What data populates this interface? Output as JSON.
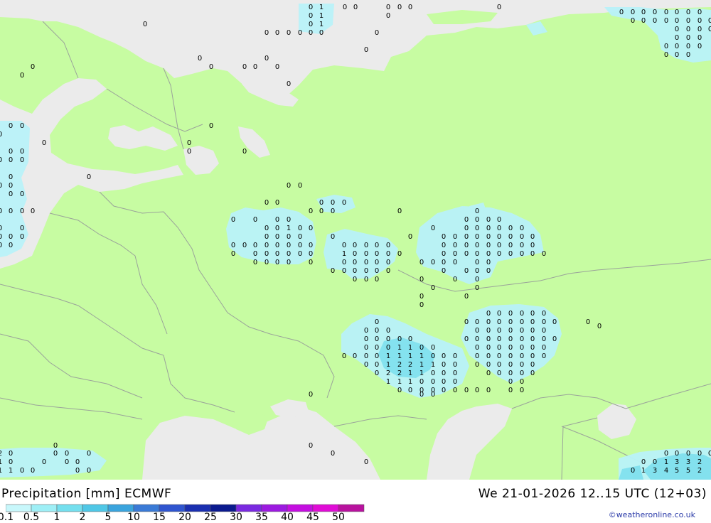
{
  "title": "Precipitation [mm] ECMWF",
  "datetime": "We 21-01-2026 12..15 UTC (12+03)",
  "credit": "©weatheronline.co.uk",
  "colors": {
    "land": "#c7fca2",
    "sea": "#ebebeb",
    "border": "#9aa39a",
    "precip_light": "#b9f2f9",
    "precip_medium": "#7ee0ee"
  },
  "legend": {
    "ticks": [
      "0.1",
      "0.5",
      "1",
      "2",
      "5",
      "10",
      "15",
      "20",
      "25",
      "30",
      "35",
      "40",
      "45",
      "50"
    ],
    "swatches": [
      "#c8f7fb",
      "#9eeff6",
      "#74dfee",
      "#4fc7e6",
      "#3aa4dd",
      "#3a7ad6",
      "#2f55cf",
      "#1a2fb0",
      "#0b1a8e",
      "#7a2ae0",
      "#9c1ae0",
      "#c40ee0",
      "#e00cd6",
      "#b8129e"
    ]
  }
}
